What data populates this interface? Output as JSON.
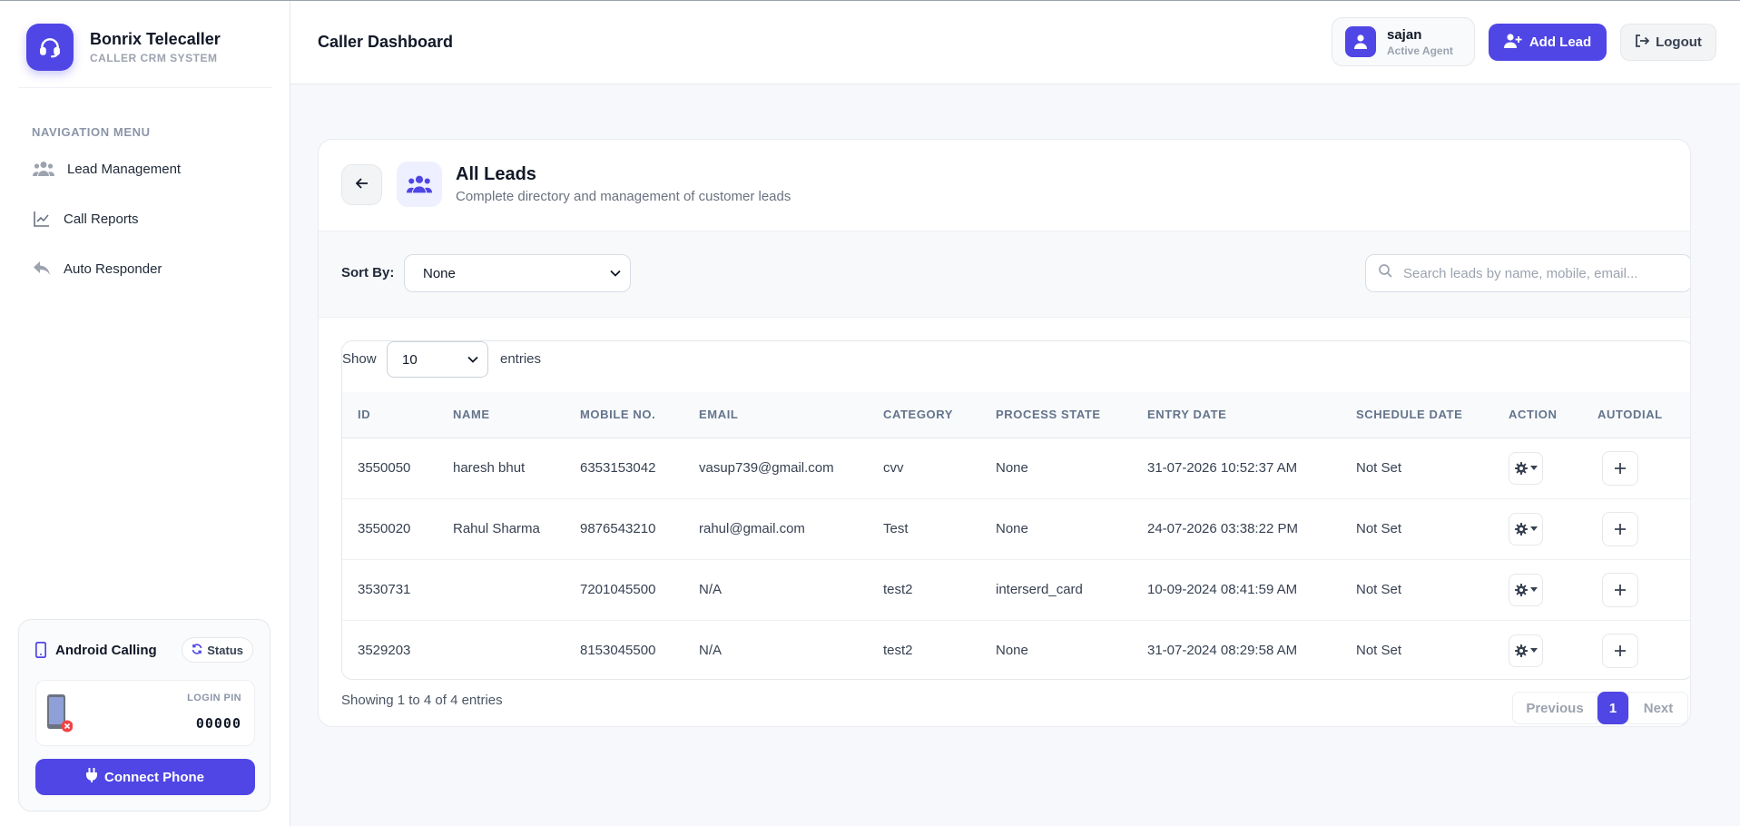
{
  "brand": {
    "title": "Bonrix Telecaller",
    "subtitle": "CALLER CRM SYSTEM"
  },
  "sidebar": {
    "heading": "NAVIGATION MENU",
    "items": [
      {
        "label": "Lead Management",
        "icon": "users-icon"
      },
      {
        "label": "Call Reports",
        "icon": "line-chart-icon"
      },
      {
        "label": "Auto Responder",
        "icon": "reply-icon"
      }
    ]
  },
  "android": {
    "title": "Android Calling",
    "status_label": "Status",
    "pin_label": "LOGIN PIN",
    "pin_value": "00000",
    "connect_label": "Connect Phone"
  },
  "header": {
    "title": "Caller Dashboard",
    "user_name": "sajan",
    "user_role": "Active Agent",
    "add_lead_label": "Add Lead",
    "logout_label": "Logout"
  },
  "card": {
    "title": "All Leads",
    "subtitle": "Complete directory and management of customer leads"
  },
  "filters": {
    "sort_label": "Sort By:",
    "sort_value": "None",
    "search_placeholder": "Search leads by name, mobile, email..."
  },
  "table": {
    "show_label": "Show",
    "entries_value": "10",
    "entries_label": "entries",
    "columns": [
      "ID",
      "NAME",
      "MOBILE NO.",
      "EMAIL",
      "CATEGORY",
      "PROCESS STATE",
      "ENTRY DATE",
      "SCHEDULE DATE",
      "ACTION",
      "AUTODIAL"
    ],
    "rows": [
      [
        "3550050",
        "haresh bhut",
        "6353153042",
        "vasup739@gmail.com",
        "cvv",
        "None",
        "31-07-2026 10:52:37 AM",
        "Not Set"
      ],
      [
        "3550020",
        "Rahul Sharma",
        "9876543210",
        "rahul@gmail.com",
        "Test",
        "None",
        "24-07-2026 03:38:22 PM",
        "Not Set"
      ],
      [
        "3530731",
        "",
        "7201045500",
        "N/A",
        "test2",
        "interserd_card",
        "10-09-2024 08:41:59 AM",
        "Not Set"
      ],
      [
        "3529203",
        "",
        "8153045500",
        "N/A",
        "test2",
        "None",
        "31-07-2024 08:29:58 AM",
        "Not Set"
      ]
    ]
  },
  "pagination": {
    "summary": "Showing 1 to 4 of 4 entries",
    "previous": "Previous",
    "current": "1",
    "next": "Next"
  },
  "colors": {
    "accent": "#4f46e5",
    "danger": "#ef4444"
  }
}
